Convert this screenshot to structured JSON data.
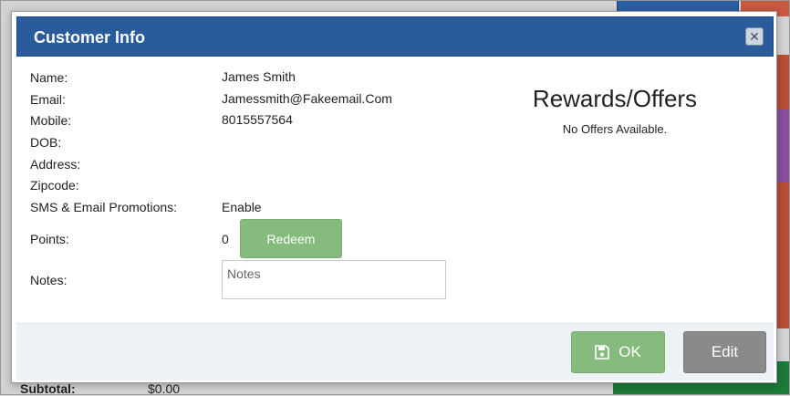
{
  "modal": {
    "title": "Customer Info",
    "close_icon": "close-icon"
  },
  "customer": {
    "fields": [
      {
        "label": "Name:",
        "value": "James Smith"
      },
      {
        "label": "Email:",
        "value": "Jamessmith@Fakeemail.Com"
      },
      {
        "label": "Mobile:",
        "value": "8015557564"
      },
      {
        "label": "DOB:",
        "value": ""
      },
      {
        "label": "Address:",
        "value": ""
      },
      {
        "label": "Zipcode:",
        "value": ""
      },
      {
        "label": "SMS & Email Promotions:",
        "value": "Enable"
      }
    ],
    "points": {
      "label": "Points:",
      "value": "0",
      "redeem_label": "Redeem"
    },
    "notes": {
      "label": "Notes:",
      "placeholder": "Notes",
      "value": ""
    }
  },
  "rewards": {
    "title": "Rewards/Offers",
    "empty_text": "No Offers Available."
  },
  "footer": {
    "ok_label": "OK",
    "ok_icon": "save-icon",
    "edit_label": "Edit"
  },
  "background": {
    "subtotal_label": "Subtotal:",
    "subtotal_value": "$0.00"
  },
  "colors": {
    "header": "#2a5c9c",
    "success": "#86bb7e",
    "neutral": "#8a8a8a"
  }
}
